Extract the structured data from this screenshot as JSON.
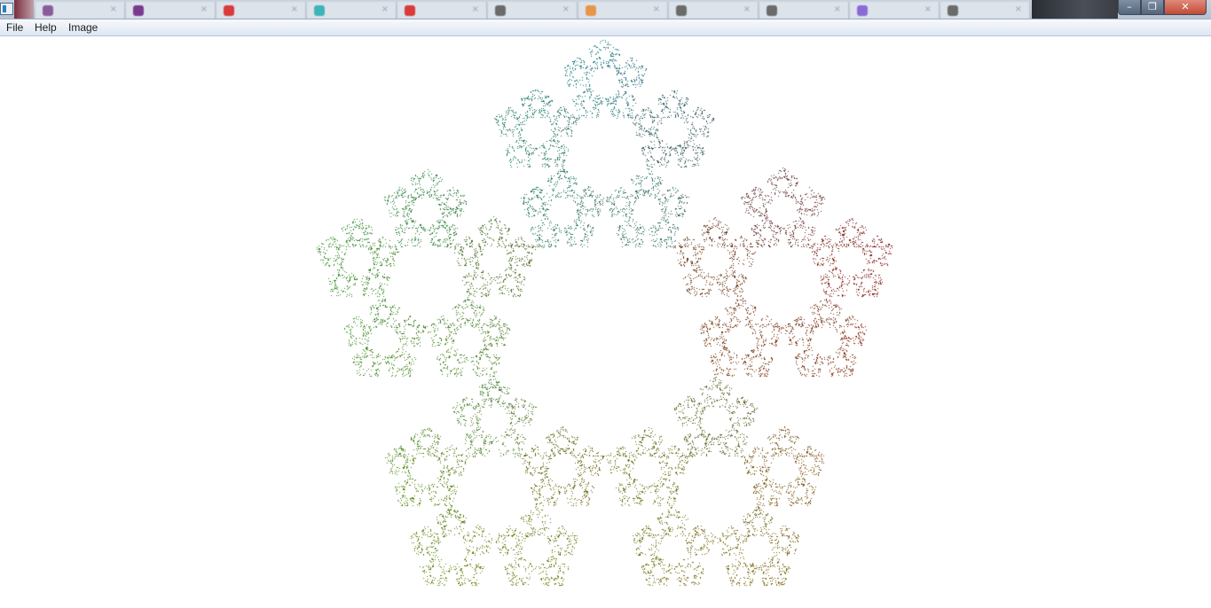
{
  "window": {
    "browser_tab_colors": [
      "#8a5d9a",
      "#7a3a8c",
      "#d93a3a",
      "#3cb4b8",
      "#d93a3a",
      "#6b6b6b",
      "#e8954a",
      "#6b6b6b",
      "#6b6b6b",
      "#8a6bd6",
      "#6b6b6b"
    ],
    "minimize_glyph": "–",
    "maximize_glyph": "❐",
    "close_glyph": "✕"
  },
  "menu": {
    "items": [
      {
        "label": "File"
      },
      {
        "label": "Help"
      },
      {
        "label": "Image"
      }
    ]
  },
  "canvas": {
    "background": "#ffffff",
    "pentagon_colors": {
      "top": "#0b6f80",
      "right": "#851010",
      "bottom_right": "#7a6405",
      "bottom_left": "#5f8407",
      "left": "#2f8a25"
    }
  }
}
